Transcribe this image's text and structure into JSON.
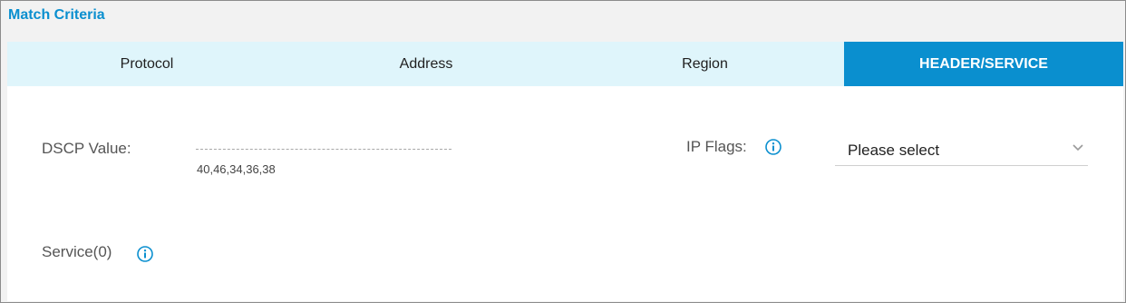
{
  "panel": {
    "title": "Match Criteria"
  },
  "tabs": [
    {
      "label": "Protocol",
      "active": false
    },
    {
      "label": "Address",
      "active": false
    },
    {
      "label": "Region",
      "active": false
    },
    {
      "label": "HEADER/SERVICE",
      "active": true
    }
  ],
  "form": {
    "dscp": {
      "label": "DSCP Value:",
      "value": "40,46,34,36,38"
    },
    "ip_flags": {
      "label": "IP Flags:",
      "info_icon": "info-circle-icon",
      "select_value": "Please select",
      "dropdown_icon": "chevron-down-icon"
    },
    "service": {
      "label": "Service(0)",
      "info_icon": "info-circle-icon"
    }
  },
  "colors": {
    "accent": "#0a8fcf",
    "tab_bar_bg": "#dff5fb",
    "panel_bg": "#f2f2f2"
  }
}
